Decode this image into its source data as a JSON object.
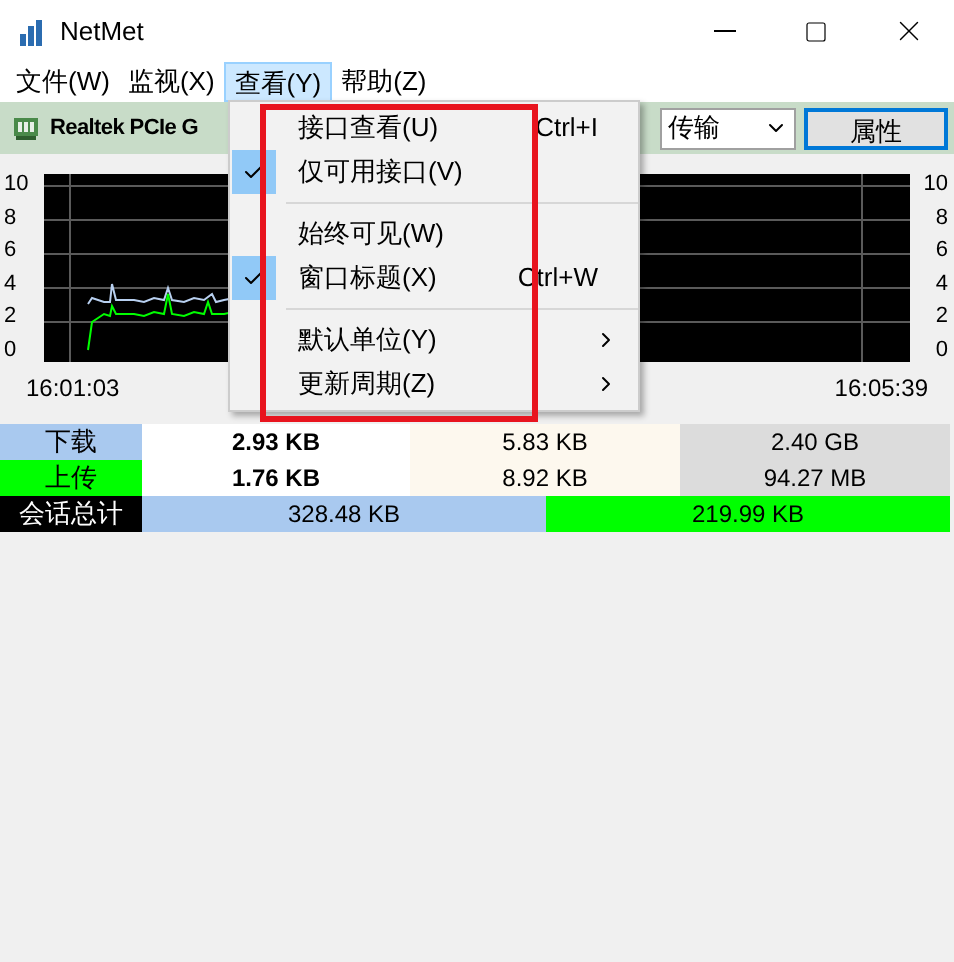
{
  "window": {
    "title": "NetMet"
  },
  "menu_bar": [
    {
      "label": "文件(W)",
      "selected": false
    },
    {
      "label": "监视(X)",
      "selected": false
    },
    {
      "label": "查看(Y)",
      "selected": true
    },
    {
      "label": "帮助(Z)",
      "selected": false
    }
  ],
  "toolbar": {
    "adapter": "Realtek PCIe G",
    "mode_select": "传输",
    "properties_button": "属性"
  },
  "graph": {
    "left_ticks": [
      "10",
      "8",
      "6",
      "4",
      "2",
      "0"
    ],
    "right_ticks": [
      "10",
      "8",
      "6",
      "4",
      "2",
      "0"
    ],
    "start_time": "16:01:03",
    "end_time": "16:05:39"
  },
  "stats": {
    "rows": [
      {
        "label": "下载",
        "color": "#a9c9ef",
        "column_2": "2.93 KB",
        "column_3": "5.83 KB",
        "column_4": "2.40 GB"
      },
      {
        "label": "上传",
        "color": "#00ff00",
        "column_2": "1.76 KB",
        "column_3": "8.92 KB",
        "column_4": "94.27 MB"
      }
    ],
    "session": {
      "label": "会话总计",
      "download": "328.48 KB",
      "upload": "219.99 KB"
    }
  },
  "open_menu": {
    "items": [
      {
        "kind": "item",
        "label": "接口查看(U)",
        "shortcut": "Ctrl+I",
        "checked": false,
        "submenu": false
      },
      {
        "kind": "item",
        "label": "仅可用接口(V)",
        "checked": true,
        "submenu": false
      },
      {
        "kind": "separator"
      },
      {
        "kind": "item",
        "label": "始终可见(W)",
        "checked": false,
        "submenu": false
      },
      {
        "kind": "item",
        "label": "窗口标题(X)",
        "shortcut": "Ctrl+W",
        "checked": true,
        "submenu": false
      },
      {
        "kind": "separator"
      },
      {
        "kind": "item",
        "label": "默认单位(Y)",
        "checked": false,
        "submenu": true
      },
      {
        "kind": "item",
        "label": "更新周期(Z)",
        "checked": false,
        "submenu": true
      }
    ]
  }
}
